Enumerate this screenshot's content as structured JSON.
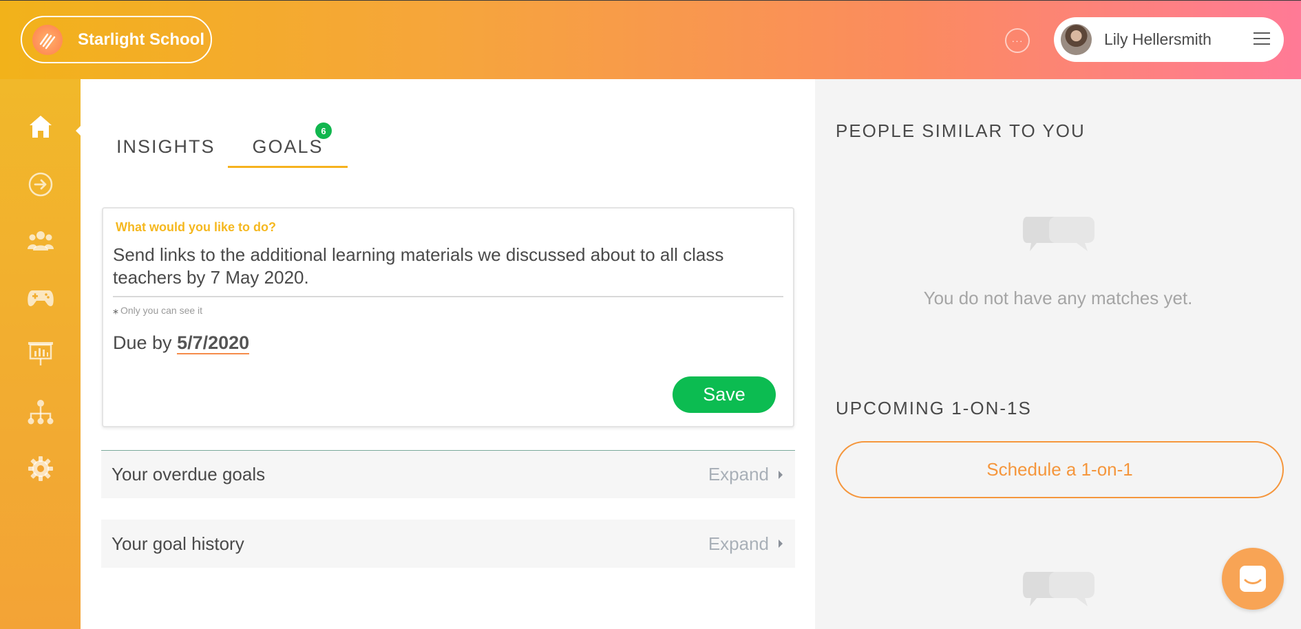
{
  "header": {
    "brand_name": "Starlight School",
    "user_name": "Lily Hellersmith",
    "more_label": "···"
  },
  "sidebar": {
    "items": [
      {
        "icon": "home-icon",
        "active": true
      },
      {
        "icon": "arrow-right-circle-icon",
        "active": false
      },
      {
        "icon": "people-icon",
        "active": false
      },
      {
        "icon": "gamepad-icon",
        "active": false
      },
      {
        "icon": "presentation-icon",
        "active": false
      },
      {
        "icon": "org-chart-icon",
        "active": false
      },
      {
        "icon": "gear-icon",
        "active": false
      }
    ]
  },
  "main": {
    "tabs": [
      {
        "label": "INSIGHTS",
        "active": false
      },
      {
        "label": "GOALS",
        "active": true,
        "badge": "6"
      }
    ],
    "goal_form": {
      "prompt": "What would you like to do?",
      "text": "Send links to the additional learning materials we discussed about to all class teachers by 7 May 2020.",
      "privacy_note": "Only you can see it",
      "due_prefix": "Due by",
      "due_date": "5/7/2020",
      "save_label": "Save"
    },
    "sections": [
      {
        "title": "Your overdue goals",
        "action": "Expand"
      },
      {
        "title": "Your goal history",
        "action": "Expand"
      }
    ]
  },
  "right_panel": {
    "people_title": "PEOPLE SIMILAR TO YOU",
    "no_matches": "You do not have any matches yet.",
    "upcoming_title": "UPCOMING 1-ON-1S",
    "schedule_label": "Schedule a 1-on-1"
  },
  "colors": {
    "accent_yellow": "#f5b820",
    "accent_orange": "#f5963c",
    "save_green": "#0cbc51",
    "badge_green": "#11b64e",
    "header_gradient_start": "#f2b21a",
    "header_gradient_end": "#ff7a96"
  }
}
